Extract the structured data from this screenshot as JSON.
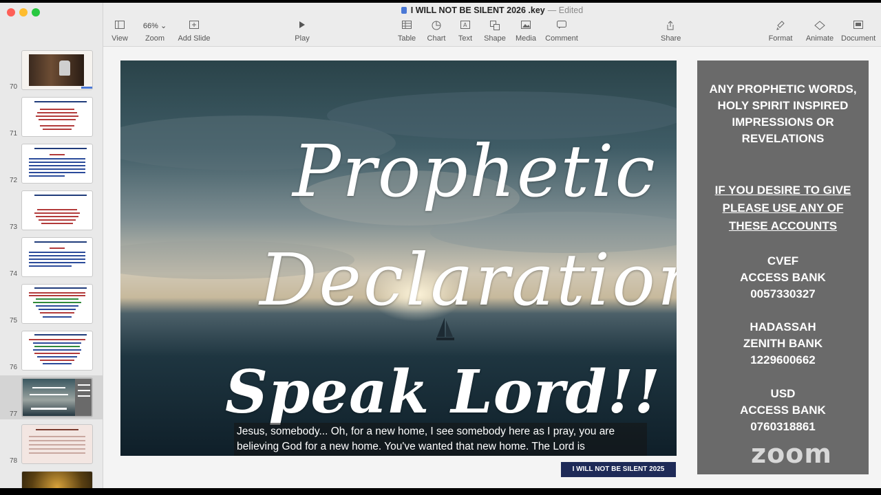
{
  "window": {
    "title": "I WILL NOT BE SILENT 2026 .key",
    "status": "Edited"
  },
  "toolbar": {
    "view": "View",
    "zoom_value": "66%",
    "zoom": "Zoom",
    "add_slide": "Add Slide",
    "play": "Play",
    "table": "Table",
    "chart": "Chart",
    "text": "Text",
    "shape": "Shape",
    "media": "Media",
    "comment": "Comment",
    "share": "Share",
    "format": "Format",
    "animate": "Animate",
    "document": "Document"
  },
  "sidebar": {
    "slides": [
      {
        "num": "70"
      },
      {
        "num": "71"
      },
      {
        "num": "72"
      },
      {
        "num": "73"
      },
      {
        "num": "74"
      },
      {
        "num": "75"
      },
      {
        "num": "76"
      },
      {
        "num": "77",
        "selected": true
      },
      {
        "num": "78"
      }
    ]
  },
  "slide": {
    "line1": "Prophetic",
    "line2": "Declarations",
    "line3": "Speak Lord!!",
    "caption": "Jesus, somebody... Oh, for a new home, I see somebody here as I pray, you are believing God for a new home. You've wanted that new home. The Lord is"
  },
  "banner": "I WILL NOT BE SILENT 2025",
  "panel": {
    "intro": [
      "ANY PROPHETIC WORDS,",
      "HOLY SPIRIT INSPIRED",
      "IMPRESSIONS OR",
      "REVELATIONS"
    ],
    "give": [
      "IF YOU DESIRE TO GIVE",
      "PLEASE USE ANY OF",
      "THESE ACCOUNTS"
    ],
    "acct1": [
      "CVEF",
      "ACCESS BANK",
      "0057330327"
    ],
    "acct2": [
      "HADASSAH",
      "ZENITH BANK",
      "1229600662"
    ],
    "acct3": [
      "USD",
      "ACCESS BANK",
      "0760318861"
    ],
    "logo": "zoom"
  },
  "colors": {
    "banner": "#1e2a57",
    "panel": "#6a6a6a",
    "accent": "#4a78d6"
  }
}
